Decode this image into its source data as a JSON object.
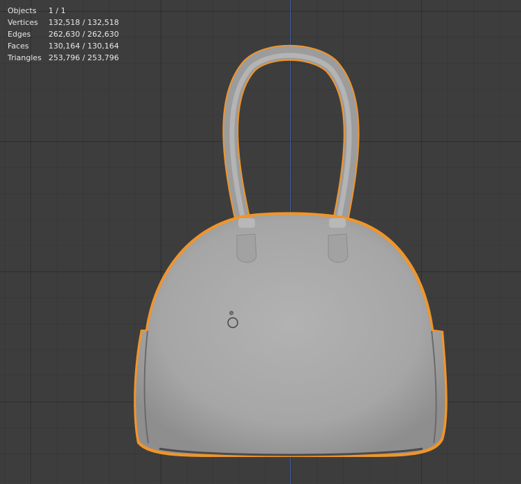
{
  "stats": {
    "rows": [
      {
        "label": "Objects",
        "value": "1 / 1"
      },
      {
        "label": "Vertices",
        "value": "132,518 / 132,518"
      },
      {
        "label": "Edges",
        "value": "262,630 / 262,630"
      },
      {
        "label": "Faces",
        "value": "130,164 / 130,164"
      },
      {
        "label": "Triangles",
        "value": "253,796 / 253,796"
      }
    ]
  },
  "colors": {
    "background": "#3d3d3d",
    "grid": "#303030",
    "axis_z": "#3f5fa0",
    "selection_outline": "#f0952a",
    "mesh": "#a9a9a9"
  },
  "icons": {
    "origin": "object-origin-icon",
    "cursor": "3d-cursor-icon"
  }
}
